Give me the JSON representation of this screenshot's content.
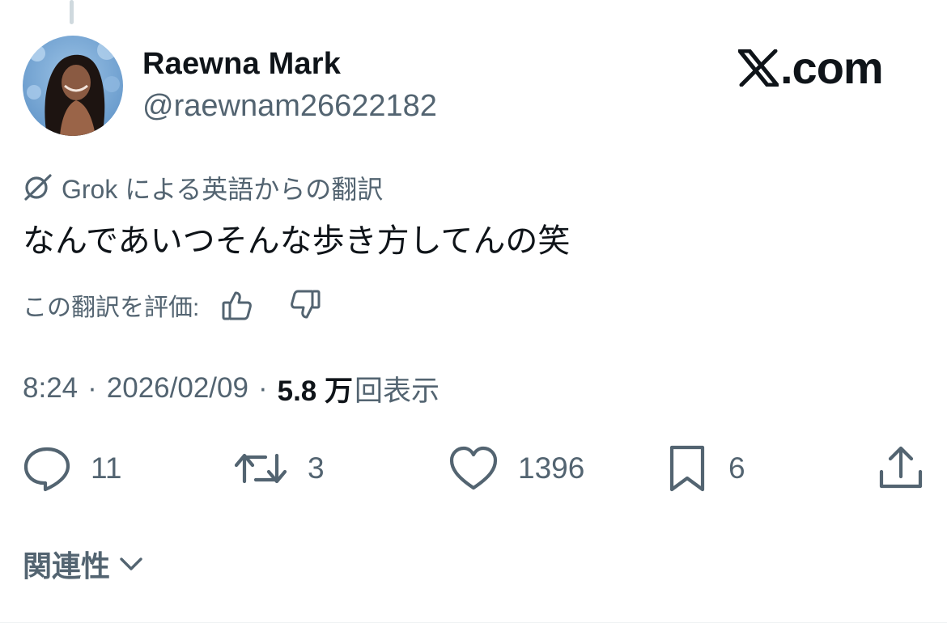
{
  "user": {
    "display_name": "Raewna Mark",
    "handle": "@raewnam26622182"
  },
  "brand": {
    "logo_text": ".com"
  },
  "translation": {
    "label": "Grok による英語からの翻訳",
    "text": "なんであいつそんな歩き方してんの笑",
    "rate_label": "この翻訳を評価:"
  },
  "meta": {
    "time": "8:24",
    "separator": "·",
    "date": "2026/02/09",
    "views_count": "5.8 万",
    "views_label": "回表示"
  },
  "actions": {
    "replies": "11",
    "reposts": "3",
    "likes": "1396",
    "bookmarks": "6"
  },
  "related": {
    "label": "関連性"
  },
  "colors": {
    "primary_text": "#0f1419",
    "secondary_text": "#536471",
    "divider": "#eff3f4"
  }
}
